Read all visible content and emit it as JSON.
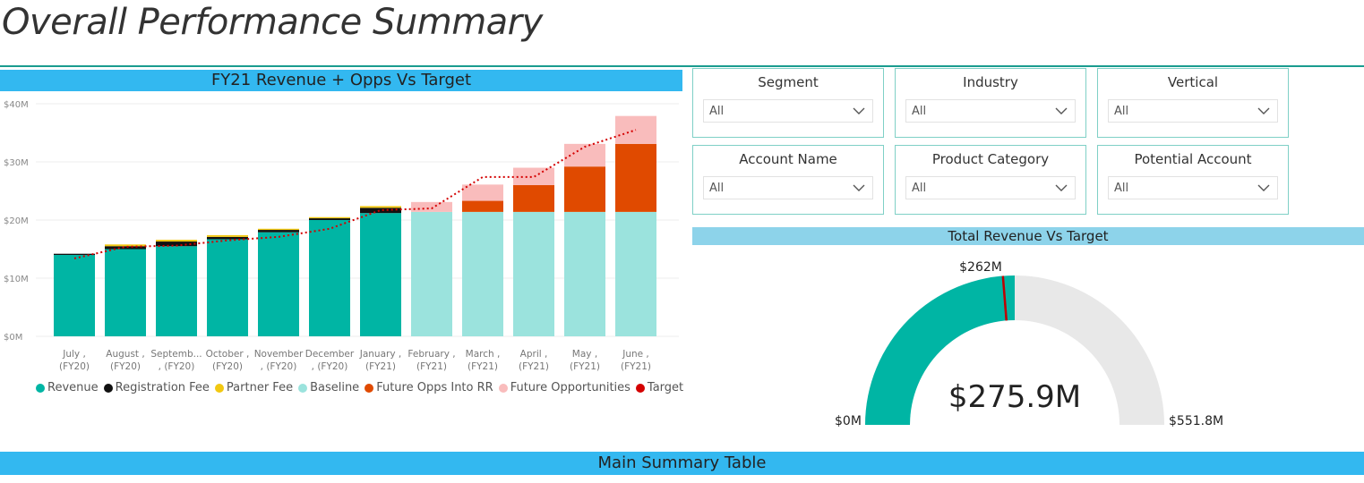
{
  "page": {
    "title": "Overall Performance Summary"
  },
  "revenue_chart": {
    "header": "FY21 Revenue + Opps Vs Target"
  },
  "legend": [
    {
      "label": "Revenue",
      "color": "#00b5a4"
    },
    {
      "label": "Registration Fee",
      "color": "#111111"
    },
    {
      "label": "Partner Fee",
      "color": "#f2c811"
    },
    {
      "label": "Baseline",
      "color": "#9be3dd"
    },
    {
      "label": "Future Opps Into RR",
      "color": "#e04a00"
    },
    {
      "label": "Future Opportunities",
      "color": "#f9bcbc"
    },
    {
      "label": "Target",
      "color": "#d40000"
    }
  ],
  "slicers": [
    {
      "label": "Segment",
      "value": "All"
    },
    {
      "label": "Industry",
      "value": "All"
    },
    {
      "label": "Vertical",
      "value": "All"
    },
    {
      "label": "Account Name",
      "value": "All"
    },
    {
      "label": "Product Category",
      "value": "All"
    },
    {
      "label": "Potential Account",
      "value": "All"
    }
  ],
  "gauge": {
    "header": "Total Revenue Vs Target",
    "value_label": "$275.9M",
    "min_label": "$0M",
    "max_label": "$551.8M",
    "target_label": "$262M",
    "value": 275.9,
    "max": 551.8,
    "target": 262,
    "fill_color": "#00b5a4",
    "track_color": "#e8e8e8",
    "target_color": "#c00000"
  },
  "bottom": {
    "header": "Main Summary Table"
  },
  "chart_data": {
    "type": "bar",
    "title": "FY21 Revenue + Opps Vs Target",
    "stacked": true,
    "ylim": [
      0,
      40
    ],
    "yticks": [
      "$0M",
      "$10M",
      "$20M",
      "$30M",
      "$40M"
    ],
    "categories": [
      [
        "July ,",
        "(FY20)"
      ],
      [
        "August ,",
        "(FY20)"
      ],
      [
        "Septemb...",
        ", (FY20)"
      ],
      [
        "October ,",
        "(FY20)"
      ],
      [
        "November",
        ", (FY20)"
      ],
      [
        "December",
        ", (FY20)"
      ],
      [
        "January ,",
        "(FY21)"
      ],
      [
        "February ,",
        "(FY21)"
      ],
      [
        "March ,",
        "(FY21)"
      ],
      [
        "April ,",
        "(FY21)"
      ],
      [
        "May ,",
        "(FY21)"
      ],
      [
        "June ,",
        "(FY21)"
      ]
    ],
    "series": [
      {
        "name": "Revenue",
        "color": "#00b5a4",
        "values": [
          14.0,
          15.0,
          15.5,
          16.7,
          17.9,
          20.0,
          21.2,
          0,
          0,
          0,
          0,
          0
        ]
      },
      {
        "name": "Registration Fee",
        "color": "#111111",
        "values": [
          0.2,
          0.5,
          0.8,
          0.4,
          0.4,
          0.3,
          0.9,
          0,
          0,
          0,
          0,
          0
        ]
      },
      {
        "name": "Partner Fee",
        "color": "#f2c811",
        "values": [
          0.0,
          0.3,
          0.3,
          0.3,
          0.2,
          0.2,
          0.3,
          0,
          0,
          0,
          0,
          0
        ]
      },
      {
        "name": "Baseline",
        "color": "#9be3dd",
        "values": [
          0,
          0,
          0,
          0,
          0,
          0,
          0,
          21.4,
          21.4,
          21.4,
          21.4,
          21.4
        ]
      },
      {
        "name": "Future Opps Into RR",
        "color": "#e04a00",
        "values": [
          0,
          0,
          0,
          0,
          0,
          0,
          0,
          0,
          1.9,
          4.6,
          7.8,
          11.7
        ]
      },
      {
        "name": "Future Opportunities",
        "color": "#f9bcbc",
        "values": [
          0,
          0,
          0,
          0,
          0,
          0,
          0,
          1.7,
          2.8,
          3.0,
          3.9,
          4.8
        ]
      }
    ],
    "target": {
      "name": "Target",
      "color": "#d40000",
      "values": [
        13.4,
        15.4,
        15.6,
        16.5,
        17.1,
        18.5,
        21.7,
        22.0,
        27.4,
        27.4,
        32.6,
        35.5
      ]
    },
    "grid": true,
    "legend_position": "bottom"
  }
}
